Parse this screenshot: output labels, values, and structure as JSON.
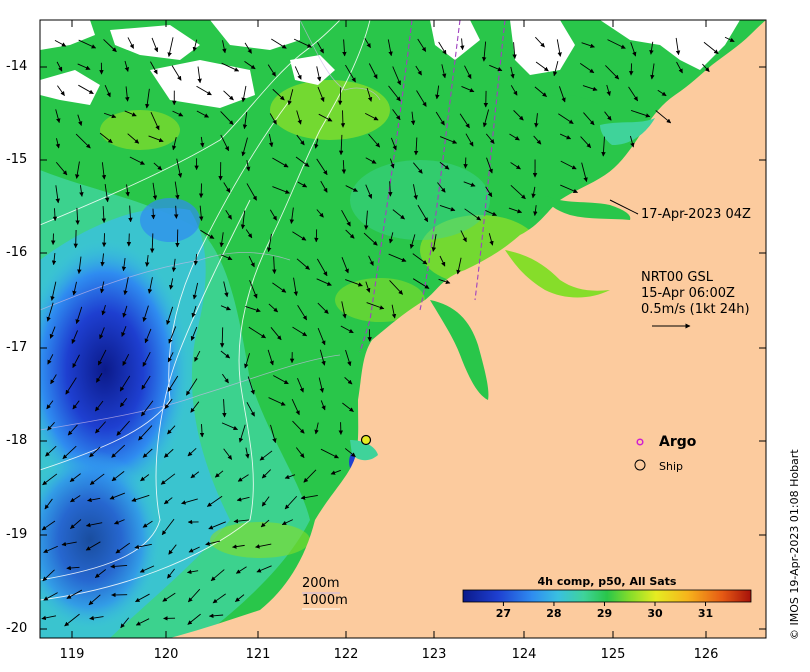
{
  "map": {
    "lon_ticks": [
      "119",
      "120",
      "121",
      "122",
      "123",
      "124",
      "125",
      "126"
    ],
    "lat_ticks": [
      "-14",
      "-15",
      "-16",
      "-17",
      "-18",
      "-19",
      "-20"
    ],
    "colors": {
      "land": "#fccb9e",
      "cloud": "#ffffff",
      "sst_scale": [
        "#0b1a8a",
        "#1e3fd0",
        "#2f8cf0",
        "#39c0e0",
        "#3fd39a",
        "#29c64a",
        "#86dd2a",
        "#e6ec22",
        "#f6b41c",
        "#e65a14",
        "#a6110a"
      ]
    }
  },
  "annotations": {
    "time_label": "17-Apr-2023 04Z",
    "currents_title": "NRT00 GSL",
    "currents_time": "15-Apr 06:00Z",
    "currents_scale": "0.5m/s (1kt 24h)",
    "isobath_200": "200m",
    "isobath_1000": "1000m"
  },
  "legend": {
    "argo_label": "Argo",
    "ship_label": "Ship"
  },
  "colorbar": {
    "title": "4h comp, p50, All Sats",
    "ticks": [
      "27",
      "28",
      "29",
      "30",
      "31"
    ],
    "range": [
      26.2,
      31.9
    ]
  },
  "credit": "© IMOS 19-Apr-2023 01:08 Hobart"
}
